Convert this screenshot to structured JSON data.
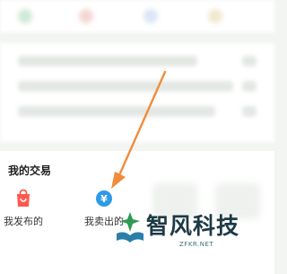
{
  "trades": {
    "title": "我的交易",
    "items": [
      {
        "label": "我发布的",
        "icon": "shopping-bag-icon",
        "color": "#ff5a4f"
      },
      {
        "label": "我卖出的",
        "icon": "yuan-coin-icon",
        "color": "#2e9ae8"
      }
    ]
  },
  "watermark": {
    "brand": "智风科技",
    "site": "ZFKR.NET"
  },
  "annotation": {
    "arrow_color": "#f08c3c"
  }
}
